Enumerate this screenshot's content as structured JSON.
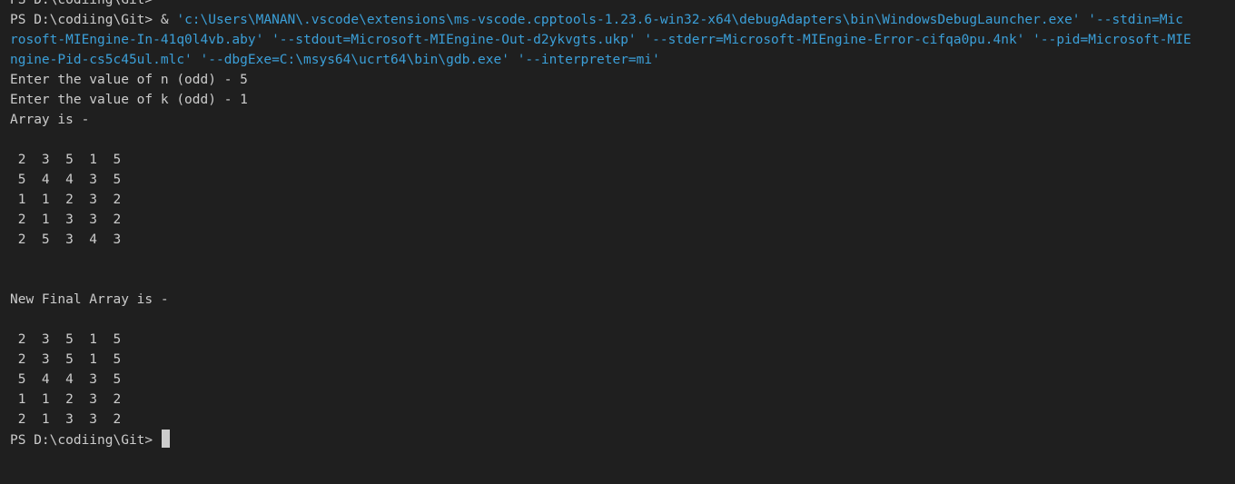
{
  "terminal": {
    "prompt_top": "PS D:\\codiing\\Git>",
    "command": {
      "prompt": "PS D:\\codiing\\Git>",
      "operator": " & ",
      "wrap1": "'c:\\Users\\MANAN\\.vscode\\extensions\\ms-vscode.cpptools-1.23.6-win32-x64\\debugAdapters\\bin\\WindowsDebugLauncher.exe' '--stdin=Mic",
      "wrap2": "rosoft-MIEngine-In-41q0l4vb.aby' '--stdout=Microsoft-MIEngine-Out-d2ykvgts.ukp' '--stderr=Microsoft-MIEngine-Error-cifqa0pu.4nk' '--pid=Microsoft-MIE",
      "wrap3": "ngine-Pid-cs5c45ul.mlc' '--dbgExe=C:\\msys64\\ucrt64\\bin\\gdb.exe' '--interpreter=mi'"
    },
    "output": {
      "line_n": "Enter the value of n (odd) - 5",
      "line_k": "Enter the value of k (odd) - 1",
      "array_label": "Array is -",
      "array_rows": [
        " 2  3  5  1  5",
        " 5  4  4  3  5",
        " 1  1  2  3  2",
        " 2  1  3  3  2",
        " 2  5  3  4  3"
      ],
      "final_label": "New Final Array is -",
      "final_rows": [
        " 2  3  5  1  5",
        " 2  3  5  1  5",
        " 5  4  4  3  5",
        " 1  1  2  3  2",
        " 2  1  3  3  2"
      ]
    },
    "prompt_bottom": "PS D:\\codiing\\Git>"
  }
}
